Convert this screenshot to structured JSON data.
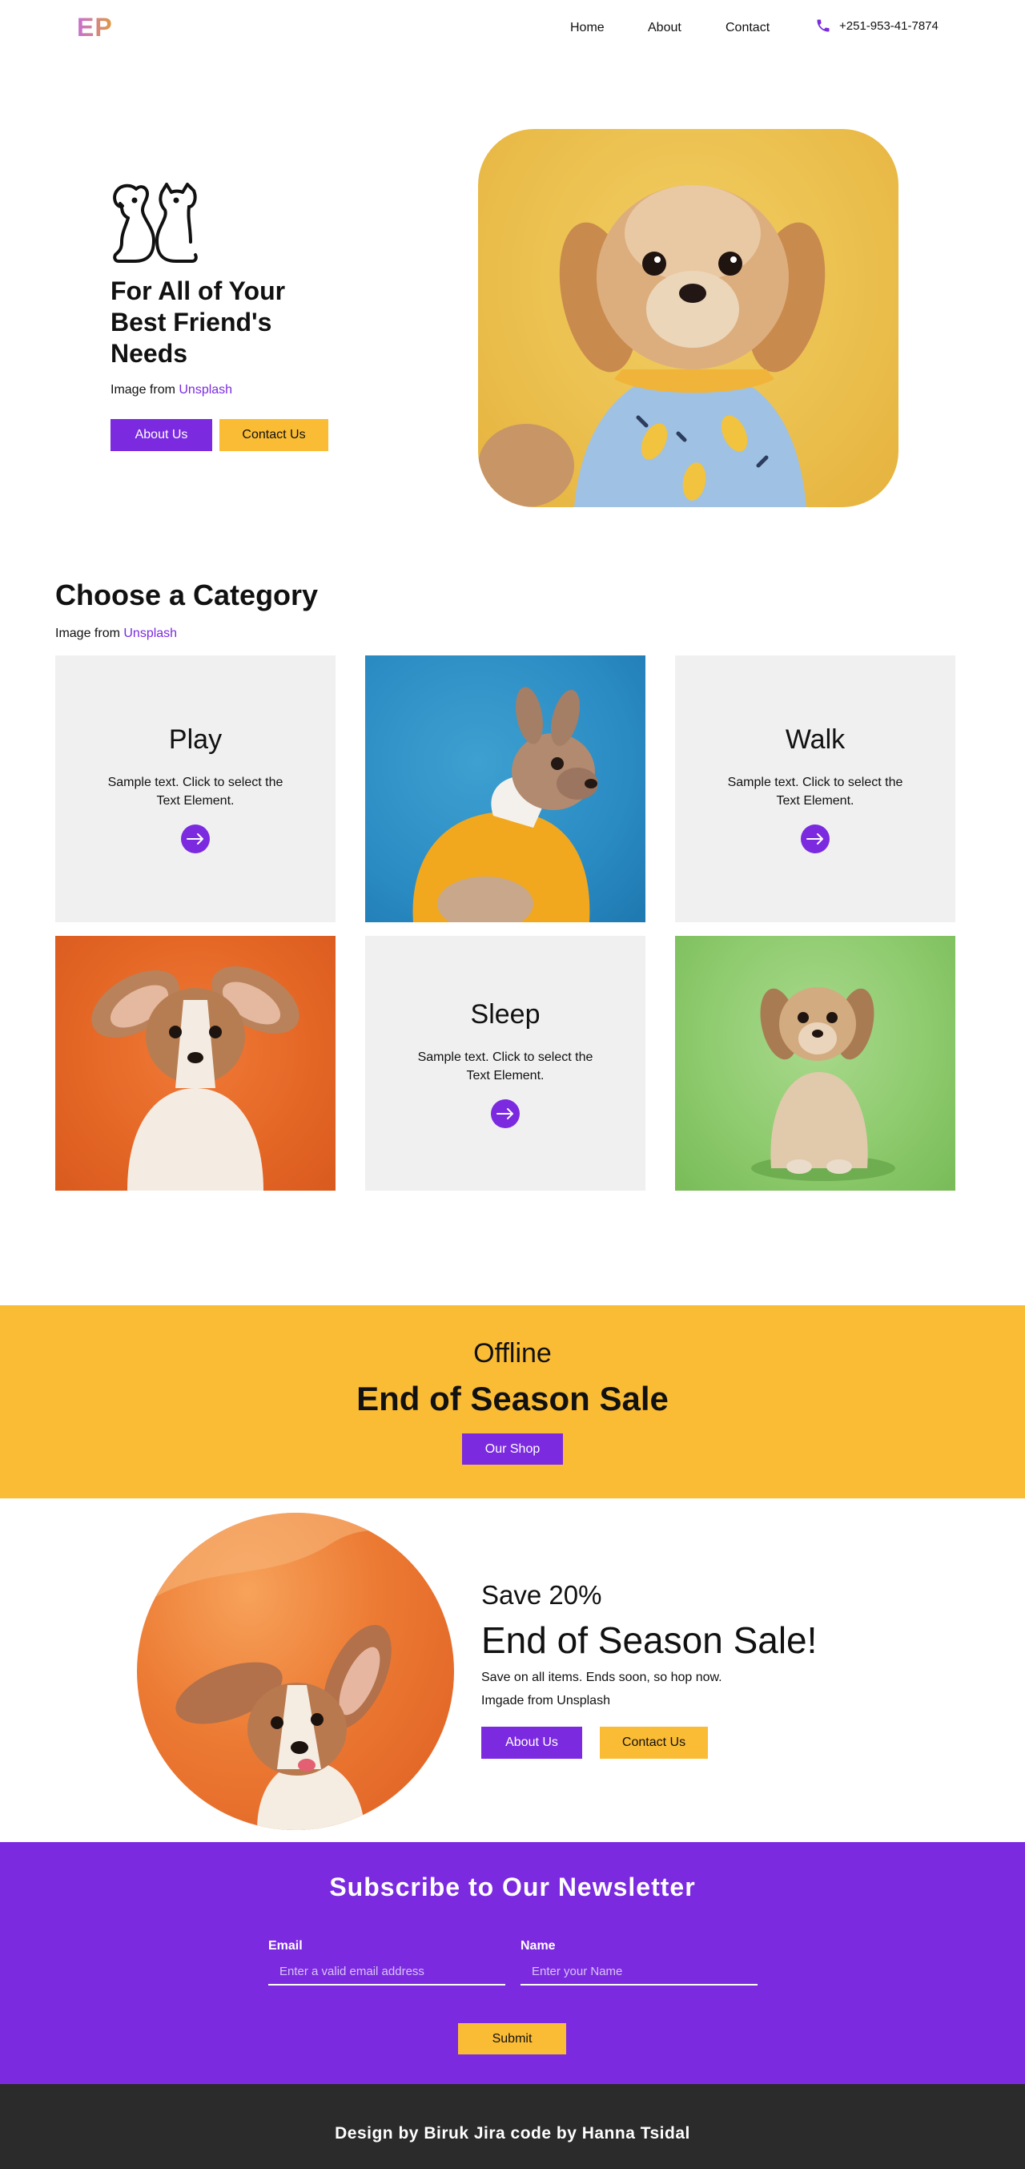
{
  "nav": {
    "logo": "EP",
    "links": [
      "Home",
      "About",
      "Contact"
    ],
    "phone": "+251-953-41-7874",
    "accent": "#7b2ae0"
  },
  "hero": {
    "title": "For All of Your Best Friend's Needs",
    "credit_prefix": "Image from ",
    "credit_link": "Unsplash",
    "about_label": "About Us",
    "contact_label": "Contact Us",
    "icon": "dog-cat-icon",
    "photo": "dog-photo-yellow-background"
  },
  "category": {
    "title": "Choose a Category",
    "credit_prefix": "Image from ",
    "credit_link": "Unsplash",
    "tiles": [
      {
        "heading": "Play",
        "desc": "Sample text. Click to select the Text Element."
      },
      {
        "heading": "Walk",
        "desc": "Sample text. Click to select the Text Element."
      },
      {
        "heading": "Sleep",
        "desc": "Sample text. Click to select the Text Element."
      }
    ],
    "photos": [
      "french-bulldog-blue-background",
      "corgi-puppy-orange-background",
      "small-dog-green-background"
    ]
  },
  "sale": {
    "kicker": "Offline",
    "title": "End of Season Sale",
    "shop_label": "Our Shop",
    "color": "#fbbc35"
  },
  "promo": {
    "kicker": "Save 20%",
    "title": "End of Season Sale!",
    "desc": "Save on all items. Ends soon, so hop now.",
    "credit": "Imgade from Unsplash",
    "about_label": "About Us",
    "contact_label": "Contact Us",
    "photo": "corgi-puppy-circle"
  },
  "newsletter": {
    "title": "Subscribe to Our Newsletter",
    "email_label": "Email",
    "email_placeholder": "Enter a valid email address",
    "name_label": "Name",
    "name_placeholder": "Enter your Name",
    "submit_label": "Submit"
  },
  "footer": {
    "text": "Design by Biruk Jira code by Hanna Tsidal"
  }
}
